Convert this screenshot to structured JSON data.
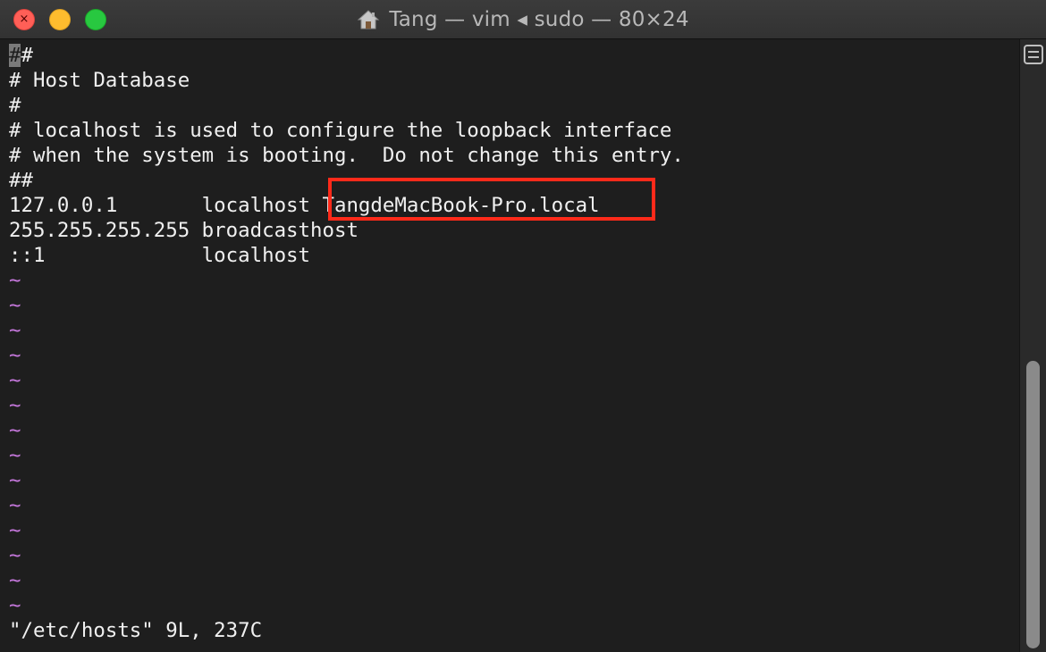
{
  "window": {
    "title": "Tang — vim ◂ sudo — 80×24",
    "title_icon": "home-icon",
    "colors": {
      "background": "#1e1e1e",
      "text": "#f0f0f0",
      "tilde": "#c678dd",
      "highlight_box": "#ff2a1a"
    }
  },
  "traffic_lights": {
    "close_glyph": "×"
  },
  "editor": {
    "lines": [
      {
        "cursor_char": "#",
        "rest": "#"
      },
      {
        "text": "# Host Database"
      },
      {
        "text": "#"
      },
      {
        "text": "# localhost is used to configure the loopback interface"
      },
      {
        "text": "# when the system is booting.  Do not change this entry."
      },
      {
        "text": "##"
      },
      {
        "text": "127.0.0.1       localhost TangdeMacBook-Pro.local"
      },
      {
        "text": "255.255.255.255 broadcasthost"
      },
      {
        "text": "::1             localhost"
      }
    ],
    "tilde": "~",
    "tilde_count": 14,
    "status_line": "\"/etc/hosts\" 9L, 237C",
    "highlighted_text": "TangdeMacBook-Pro.local"
  }
}
